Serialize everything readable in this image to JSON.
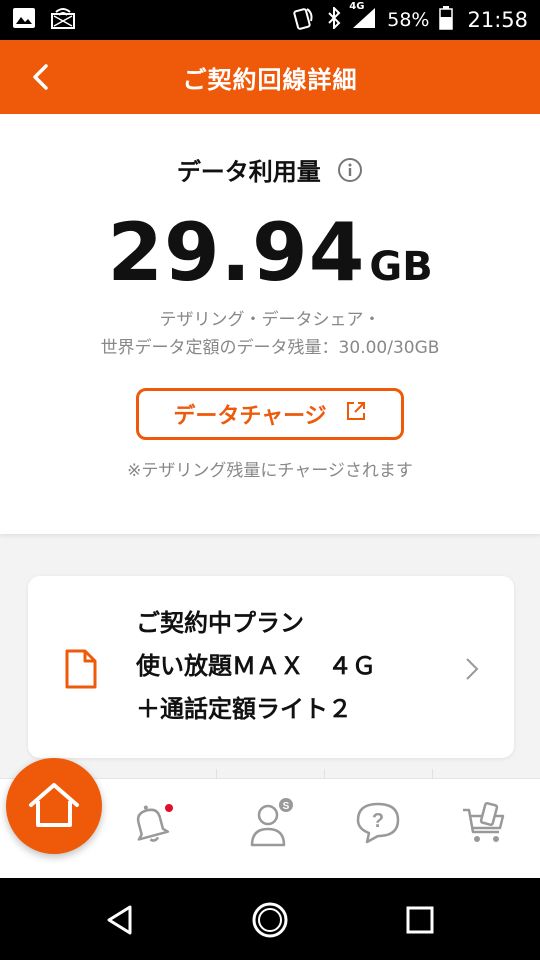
{
  "status_bar": {
    "battery": "58%",
    "time": "21:58",
    "network": "4G"
  },
  "header": {
    "title": "ご契約回線詳細",
    "back_icon": "chevron-left-icon"
  },
  "usage": {
    "title": "データ利用量",
    "amount": "29.94",
    "unit": "GB",
    "remaining_line1": "テザリング・データシェア・",
    "remaining_line2": "世界データ定額のデータ残量：30.00/30GB",
    "charge_button": "データチャージ",
    "note": "※テザリング残量にチャージされます"
  },
  "plan": {
    "line1": "ご契約中プラン",
    "line2": "使い放題ＭＡＸ　４Ｇ",
    "line3": "＋通話定額ライト２"
  },
  "bottom_nav": {
    "items": [
      "home-icon",
      "bell-icon",
      "account-icon",
      "help-icon",
      "shop-icon"
    ]
  },
  "colors": {
    "accent": "#ee5a0a",
    "notification_dot": "#e0102a"
  }
}
